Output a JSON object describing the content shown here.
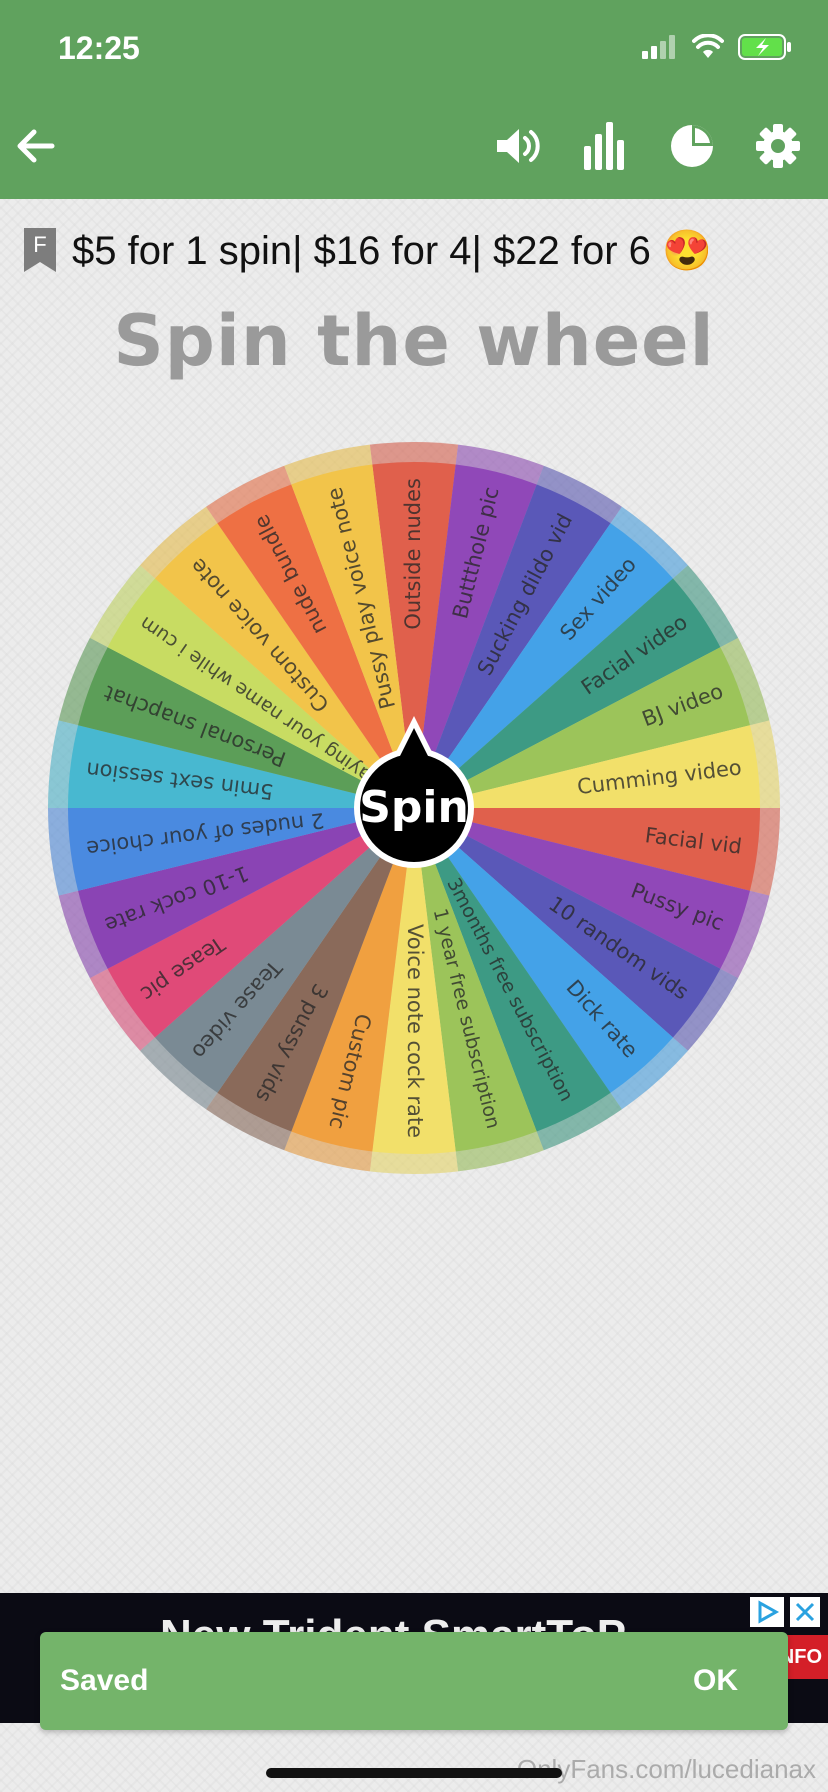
{
  "status_bar": {
    "time": "12:25"
  },
  "toolbar": {
    "back_icon": "arrow-left-icon",
    "sound_icon": "speaker-icon",
    "stats_icon": "bar-chart-icon",
    "pie_icon": "pie-chart-icon",
    "settings_icon": "gear-icon"
  },
  "pricing": {
    "badge_letter": "F",
    "text": "$5 for 1 spin| $16 for 4| $22 for 6 😍"
  },
  "title": "Spin the wheel",
  "wheel": {
    "spin_label": "Spin",
    "segments": [
      {
        "label": "Outside nudes",
        "color": "#e0604c"
      },
      {
        "label": "Buttthole pic",
        "color": "#9048b8"
      },
      {
        "label": "Sucking dildo vid",
        "color": "#5a58b8"
      },
      {
        "label": "Sex video",
        "color": "#44a2e8"
      },
      {
        "label": "Facial video",
        "color": "#3d9a84"
      },
      {
        "label": "BJ video",
        "color": "#9cc45a"
      },
      {
        "label": "Cumming video",
        "color": "#f2e06a"
      },
      {
        "label": "Facial vid",
        "color": "#e0604c"
      },
      {
        "label": "Pussy pic",
        "color": "#9048b8"
      },
      {
        "label": "10 random vids",
        "color": "#5a58b8"
      },
      {
        "label": "Dick rate",
        "color": "#44a2e8"
      },
      {
        "label": "3months free subscription",
        "color": "#3d9a84"
      },
      {
        "label": "1 year free subscription",
        "color": "#9cc45a"
      },
      {
        "label": "Voice note cock rate",
        "color": "#f2e06a"
      },
      {
        "label": "Custom pic",
        "color": "#f0a040"
      },
      {
        "label": "3 pussy vids",
        "color": "#8a6a5a"
      },
      {
        "label": "Tease video",
        "color": "#7a8a94"
      },
      {
        "label": "Tease pic",
        "color": "#e04a78"
      },
      {
        "label": "1-10 cock rate",
        "color": "#8a44b4"
      },
      {
        "label": "2 nudes of your choice",
        "color": "#4a8ae0"
      },
      {
        "label": "5min sext session",
        "color": "#48b8d0"
      },
      {
        "label": "Personal snapchat",
        "color": "#5c9e58"
      },
      {
        "label": "Saying your name while i cum",
        "color": "#c8dc62"
      },
      {
        "label": "Custom voice note",
        "color": "#f2c44a"
      },
      {
        "label": "nude bundle",
        "color": "#ee7044"
      },
      {
        "label": "Pussy play voice note",
        "color": "#f2c44a"
      }
    ]
  },
  "ad": {
    "headline": "New Trident SmartToP",
    "info_label": "NFO"
  },
  "toast": {
    "message": "Saved",
    "action": "OK"
  },
  "watermark": "OnlyFans.com/lucedianax"
}
